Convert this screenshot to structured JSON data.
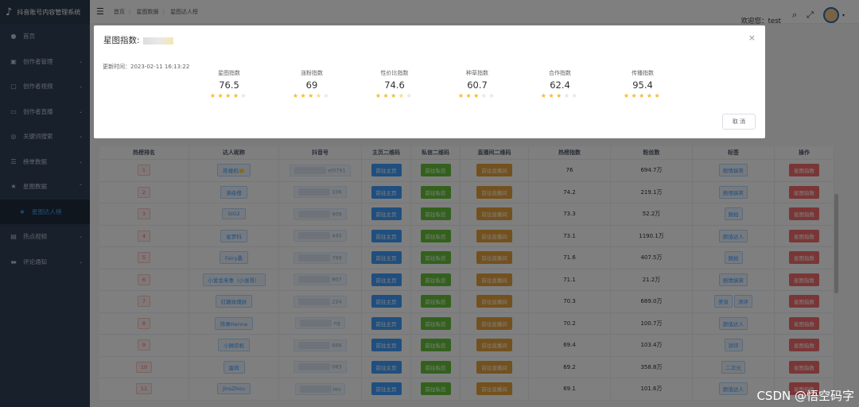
{
  "sidebar": {
    "logo_text": "抖音账号内容管理系统",
    "items": [
      {
        "icon": "●",
        "label": "首页",
        "arrow": ""
      },
      {
        "icon": "▣",
        "label": "创作者管理",
        "arrow": "⌄"
      },
      {
        "icon": "▢",
        "label": "创作者视频",
        "arrow": "⌄"
      },
      {
        "icon": "▭",
        "label": "创作者直播",
        "arrow": "⌄"
      },
      {
        "icon": "◎",
        "label": "关键词搜索",
        "arrow": "⌄"
      },
      {
        "icon": "☰",
        "label": "榜单数据",
        "arrow": "⌄"
      },
      {
        "icon": "★",
        "label": "星图数据",
        "arrow": "⌃"
      }
    ],
    "sub_item": {
      "icon": "★",
      "label": "星图达人榜"
    },
    "items2": [
      {
        "icon": "▤",
        "label": "热点视频",
        "arrow": "⌄"
      },
      {
        "icon": "▬",
        "label": "评论通知",
        "arrow": "⌄"
      }
    ]
  },
  "navbar": {
    "breadcrumb": [
      "首页",
      "星图数据",
      "星图达人榜"
    ],
    "welcome": "欢迎您：test"
  },
  "table": {
    "headers": [
      "热榜排名",
      "达人昵称",
      "抖音号",
      "主页二维码",
      "私信二维码",
      "直播间二维码",
      "热榜指数",
      "粉丝数",
      "标签",
      "操作"
    ],
    "btn_home": "前往主页",
    "btn_msg": "前往私信",
    "btn_live": "前往直播间",
    "btn_star": "星图指数",
    "rows": [
      {
        "rank": "1",
        "nick": "陈楼机🌟",
        "acct": "el0791",
        "hot": "76",
        "fans": "694.7万",
        "tags": [
          "剧情搞笑"
        ]
      },
      {
        "rank": "2",
        "nick": "满级僧",
        "acct": "106",
        "hot": "74.2",
        "fans": "219.1万",
        "tags": [
          "剧情搞笑"
        ]
      },
      {
        "rank": "3",
        "nick": "SIO2",
        "acct": "909",
        "hot": "73.3",
        "fans": "52.2万",
        "tags": [
          "随拍"
        ]
      },
      {
        "rank": "4",
        "nick": "星梦科",
        "acct": "445",
        "hot": "73.1",
        "fans": "1190.1万",
        "tags": [
          "颜值达人"
        ]
      },
      {
        "rank": "5",
        "nick": "Fairy桑",
        "acct": "799",
        "hot": "71.6",
        "fans": "407.5万",
        "tags": [
          "随拍"
        ]
      },
      {
        "rank": "6",
        "nick": "小爱会来事（小张哥）",
        "acct": "807",
        "hot": "71.1",
        "fans": "21.2万",
        "tags": [
          "剧情搞笑"
        ]
      },
      {
        "rank": "7",
        "nick": "红糖玫瑰妖",
        "acct": "224",
        "hot": "70.3",
        "fans": "689.0万",
        "tags": [
          "美妆",
          "测评"
        ]
      },
      {
        "rank": "8",
        "nick": "陈栗Hanna",
        "acct": "ng",
        "hot": "70.2",
        "fans": "100.7万",
        "tags": [
          "颜值达人"
        ]
      },
      {
        "rank": "9",
        "nick": "小狮农机",
        "acct": "666",
        "hot": "69.4",
        "fans": "103.4万",
        "tags": [
          "测评"
        ]
      },
      {
        "rank": "10",
        "nick": "蛋肉",
        "acct": "083",
        "hot": "69.2",
        "fans": "358.8万",
        "tags": [
          "二次元"
        ]
      },
      {
        "rank": "11",
        "nick": "JinsZhou",
        "acct": "iou",
        "hot": "69.1",
        "fans": "101.6万",
        "tags": [
          "颜值达人"
        ]
      }
    ]
  },
  "dialog": {
    "title": "星图指数:",
    "close": "×",
    "update_time": "更新时间：2023-02-11 16:13:22",
    "metrics": [
      {
        "label": "星图指数",
        "value": "76.5",
        "stars": 4
      },
      {
        "label": "涨粉指数",
        "value": "69",
        "stars": 3.5
      },
      {
        "label": "性价比指数",
        "value": "74.6",
        "stars": 3.5
      },
      {
        "label": "种草指数",
        "value": "60.7",
        "stars": 3
      },
      {
        "label": "合作指数",
        "value": "62.4",
        "stars": 3
      },
      {
        "label": "传播指数",
        "value": "95.4",
        "stars": 5
      }
    ],
    "cancel": "取 消"
  },
  "watermark": "CSDN @悟空码字"
}
